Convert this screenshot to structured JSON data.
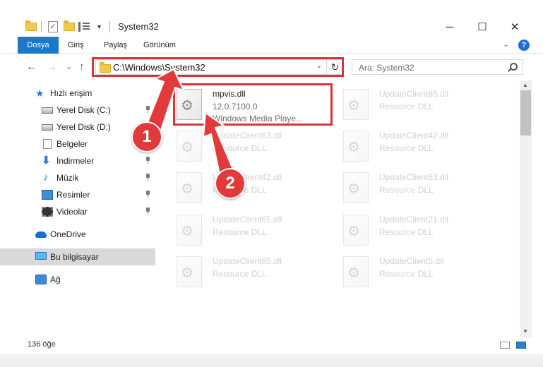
{
  "window": {
    "title": "System32",
    "minimize_glyph": "─",
    "maximize_glyph": "☐",
    "close_glyph": "✕"
  },
  "ribbon": {
    "tabs": [
      "Dosya",
      "Giriş",
      "Paylaş",
      "Görünüm"
    ],
    "help_glyph": "?",
    "collapse_glyph": "⌄"
  },
  "nav": {
    "back_glyph": "←",
    "forward_glyph": "→",
    "recent_glyph": "⌄",
    "up_glyph": "↑",
    "address": "C:\\Windows\\System32",
    "address_dropdown_glyph": "⌄",
    "refresh_glyph": "↻",
    "search_placeholder": "Ara: System32"
  },
  "sidebar": {
    "items": [
      {
        "label": "Hızlı erişim",
        "icon": "star-icon"
      },
      {
        "label": "Yerel Disk (C:)",
        "icon": "drive-icon",
        "pinned": true
      },
      {
        "label": "Yerel Disk (D:)",
        "icon": "drive-icon"
      },
      {
        "label": "Belgeler",
        "icon": "documents-icon"
      },
      {
        "label": "İndirmeler",
        "icon": "downloads-icon",
        "pinned": true
      },
      {
        "label": "Müzik",
        "icon": "music-icon",
        "pinned": true
      },
      {
        "label": "Resimler",
        "icon": "pictures-icon",
        "pinned": true
      },
      {
        "label": "Videolar",
        "icon": "videos-icon",
        "pinned": true
      },
      {
        "label": "OneDrive",
        "icon": "onedrive-icon"
      },
      {
        "label": "Bu bilgisayar",
        "icon": "this-pc-icon",
        "selected": true
      },
      {
        "label": "Ağ",
        "icon": "network-icon"
      }
    ],
    "star_glyph": "★",
    "download_glyph": "⬇",
    "music_glyph": "♪"
  },
  "files": {
    "selected": {
      "name": "mpvis.dll",
      "version": "12.0.7100.0",
      "description": "Windows Media Playe..."
    },
    "faded": [
      {
        "name": "UpdateClient65.dll",
        "type": "Resource DLL"
      },
      {
        "name": "UpdateClient63.dll",
        "type": "Resource DLL"
      },
      {
        "name": "UpdateClient42.dll",
        "type": "Resource DLL"
      },
      {
        "name": "UpdateClient42.dll",
        "type": "Resource DLL"
      },
      {
        "name": "UpdateClient63.dll",
        "type": "Resource DLL"
      },
      {
        "name": "UpdateClient65.dll",
        "type": "Resource DLL"
      },
      {
        "name": "UpdateClient21.dll",
        "type": "Resource DLL"
      },
      {
        "name": "UpdateClient65.dll",
        "type": "Resource DLL"
      },
      {
        "name": "UpdateClient5.dll",
        "type": "Resource DLL"
      }
    ]
  },
  "status": {
    "item_count": "136 öğe"
  },
  "annotations": {
    "step1": "1",
    "step2": "2",
    "color": "#e23a3a"
  }
}
